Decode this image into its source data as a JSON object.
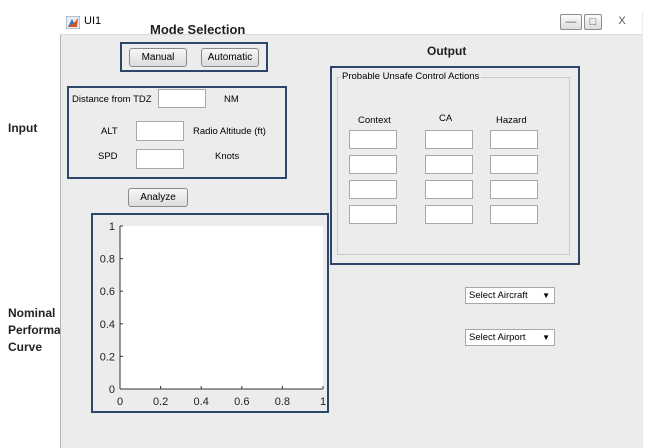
{
  "window": {
    "title": "UI1",
    "minimize": "—",
    "maximize": "□",
    "close": "X"
  },
  "side_labels": {
    "input": "Input",
    "nominal": [
      "Nominal",
      "Performance",
      "Curve"
    ]
  },
  "mode_selection": {
    "title": "Mode Selection",
    "manual_label": "Manual",
    "automatic_label": "Automatic"
  },
  "input": {
    "distance_label": "Distance from TDZ",
    "distance_value": "",
    "distance_unit": "NM",
    "alt_label": "ALT",
    "alt_value": "",
    "alt_unit": "Radio Altitude (ft)",
    "spd_label": "SPD",
    "spd_value": "",
    "spd_unit": "Knots"
  },
  "analyze_label": "Analyze",
  "output": {
    "title": "Output",
    "group_title": "Probable Unsafe Control Actions",
    "columns": [
      "Context",
      "CA",
      "Hazard"
    ],
    "rows": [
      [
        "",
        "",
        ""
      ],
      [
        "",
        "",
        ""
      ],
      [
        "",
        "",
        ""
      ],
      [
        "",
        "",
        ""
      ]
    ]
  },
  "selects": {
    "aircraft": "Select Aircraft",
    "airport": "Select Airport"
  },
  "chart_data": {
    "type": "line",
    "title": "",
    "xlabel": "",
    "ylabel": "",
    "xlim": [
      0,
      1
    ],
    "ylim": [
      0,
      1
    ],
    "xticks": [
      "0",
      "0.2",
      "0.4",
      "0.6",
      "0.8",
      "1"
    ],
    "yticks": [
      "0",
      "0.2",
      "0.4",
      "0.6",
      "0.8",
      "1"
    ],
    "series": []
  }
}
